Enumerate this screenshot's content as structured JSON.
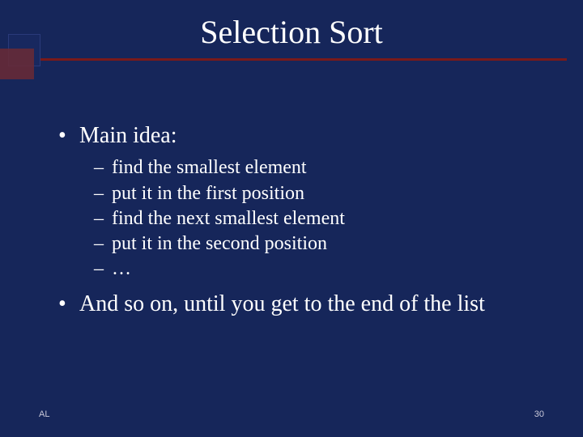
{
  "title": "Selection Sort",
  "bullets": [
    {
      "text": "Main idea:",
      "sub": [
        "find the smallest element",
        "put it in the first position",
        "find the next smallest element",
        "put it in the second position",
        "…"
      ]
    },
    {
      "text": "And so on, until you get to the end of the list",
      "sub": []
    }
  ],
  "footer": {
    "left": "AL",
    "right": "30"
  }
}
